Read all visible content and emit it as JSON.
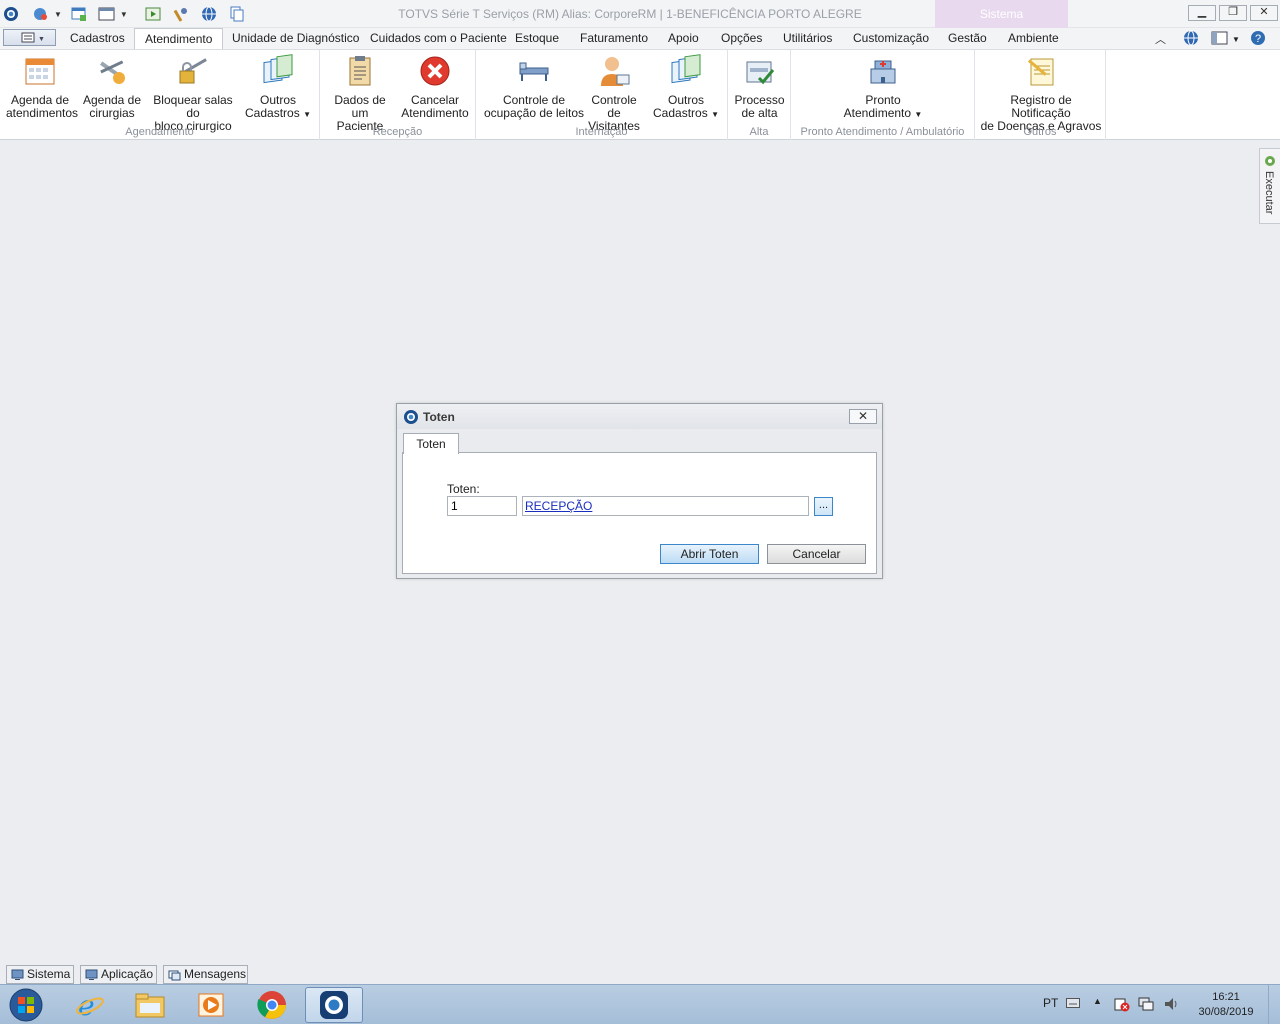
{
  "titlebar": {
    "title": "TOTVS Série T Serviços (RM) Alias: CorporeRM | 1-BENEFICÊNCIA PORTO ALEGRE",
    "context_tab": "Sistema",
    "icons": [
      "app-logo-icon",
      "quick-access-icon",
      "new-window-icon",
      "layout-icon",
      "run-icon",
      "tools-icon",
      "globe-icon",
      "copy-icon"
    ],
    "window_controls": [
      "minimize",
      "restore",
      "close"
    ]
  },
  "menu": {
    "tabs": [
      "Cadastros",
      "Atendimento",
      "Unidade de Diagnóstico",
      "Cuidados com o Paciente",
      "Estoque",
      "Faturamento",
      "Apoio",
      "Opções",
      "Utilitários",
      "Customização",
      "Gestão",
      "Ambiente"
    ],
    "active": "Atendimento"
  },
  "ribbon": {
    "groups": [
      {
        "label": "Agendamento",
        "buttons": [
          {
            "line1": "Agenda de",
            "line2": "atendimentos"
          },
          {
            "line1": "Agenda de",
            "line2": "cirurgias"
          },
          {
            "line1": "Bloquear salas do",
            "line2": "bloco cirurgico"
          },
          {
            "line1": "Outros",
            "line2": "Cadastros"
          }
        ]
      },
      {
        "label": "Recepção",
        "buttons": [
          {
            "line1": "Dados de um",
            "line2": "Paciente"
          },
          {
            "line1": "Cancelar",
            "line2": "Atendimento"
          }
        ]
      },
      {
        "label": "Internação",
        "buttons": [
          {
            "line1": "Controle de",
            "line2": "ocupação de leitos"
          },
          {
            "line1": "Controle de",
            "line2": "Visitantes"
          },
          {
            "line1": "Outros",
            "line2": "Cadastros"
          }
        ]
      },
      {
        "label": "Alta",
        "buttons": [
          {
            "line1": "Processo",
            "line2": "de alta"
          }
        ]
      },
      {
        "label": "Pronto Atendimento / Ambulatório",
        "buttons": [
          {
            "line1": "Pronto",
            "line2": "Atendimento"
          }
        ]
      },
      {
        "label": "Outros",
        "buttons": [
          {
            "line1": "Registro de Notificação",
            "line2": "de Doenças e Agravos"
          }
        ]
      }
    ]
  },
  "side_panel": {
    "label": "Executar"
  },
  "dialog": {
    "title": "Toten",
    "tab": "Toten",
    "field_label": "Toten:",
    "code_value": "1",
    "name_value": "RECEPÇÃO",
    "browse_label": "...",
    "ok_label": "Abrir Toten",
    "cancel_label": "Cancelar"
  },
  "bottom_tabs": [
    "Sistema",
    "Aplicação",
    "Mensagens"
  ],
  "taskbar": {
    "apps": [
      "start-orb",
      "internet-explorer",
      "file-explorer",
      "media-player",
      "chrome",
      "totvs-rm"
    ],
    "active": "totvs-rm",
    "language": "PT",
    "time": "16:21",
    "date": "30/08/2019"
  },
  "colors": {
    "workspace": "#ebedf0",
    "ribbon": "#ffffff",
    "context_tab": "#e8d9ee",
    "link": "#1a2fbd",
    "accent_border": "#3c87c9",
    "taskbar": "#b9cde2"
  }
}
